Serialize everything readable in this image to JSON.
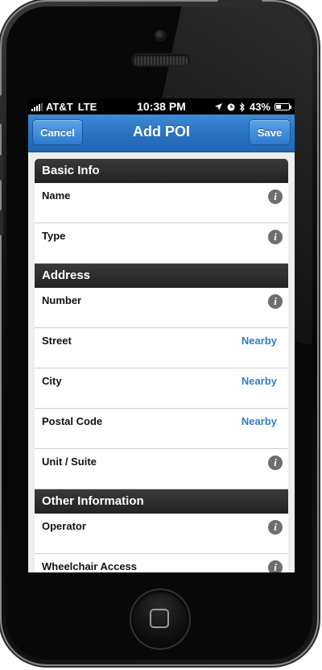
{
  "status_bar": {
    "carrier": "AT&T",
    "network": "LTE",
    "time": "10:38 PM",
    "battery": "43%",
    "battery_level": 0.43,
    "icons": [
      "signal-icon",
      "location-arrow-icon",
      "clock-icon",
      "bluetooth-icon",
      "battery-icon"
    ]
  },
  "nav": {
    "cancel_label": "Cancel",
    "title": "Add POI",
    "save_label": "Save"
  },
  "sections": {
    "basic": {
      "title": "Basic Info",
      "rows": [
        {
          "label": "Name",
          "action": "info"
        },
        {
          "label": "Type",
          "action": "info"
        }
      ]
    },
    "address": {
      "title": "Address",
      "rows": [
        {
          "label": "Number",
          "action": "info"
        },
        {
          "label": "Street",
          "action": "Nearby"
        },
        {
          "label": "City",
          "action": "Nearby"
        },
        {
          "label": "Postal Code",
          "action": "Nearby"
        },
        {
          "label": "Unit / Suite",
          "action": "info"
        }
      ]
    },
    "other": {
      "title": "Other Information",
      "rows": [
        {
          "label": "Operator",
          "action": "info"
        },
        {
          "label": "Wheelchair Access",
          "action": "info"
        }
      ]
    }
  },
  "info_icon_glyph": "i",
  "colors": {
    "nav_blue": "#2a74c3",
    "link_blue": "#2f7cc4",
    "section_header": "#2a2a2a"
  }
}
